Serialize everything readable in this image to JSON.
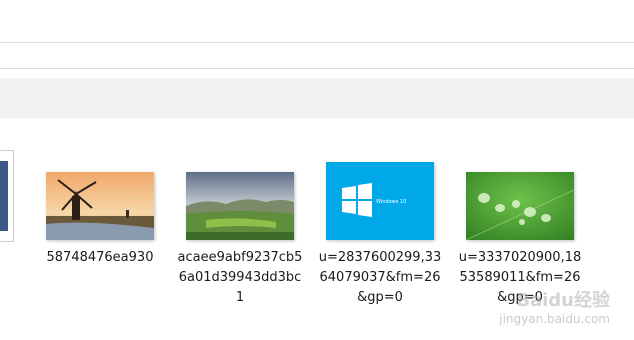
{
  "files": [
    {
      "name": "58748476ea930",
      "thumbnail_icon": "windmill-photo"
    },
    {
      "name": "acaee9abf9237cb56a01d39943dd3bc1",
      "thumbnail_icon": "landscape-photo"
    },
    {
      "name": "u=2837600299,3364079037&fm=26&gp=0",
      "thumbnail_icon": "windows10-logo",
      "thumb_text": "Windows 10"
    },
    {
      "name": "u=3337020900,1853589011&fm=26&gp=0",
      "thumbnail_icon": "water-drops-photo"
    }
  ],
  "watermark": {
    "logo_text": "Baidu经验",
    "url": "jingyan.baidu.com"
  },
  "colors": {
    "windows_blue": "#00a8e8",
    "leaf_green": "#3f9e32"
  }
}
